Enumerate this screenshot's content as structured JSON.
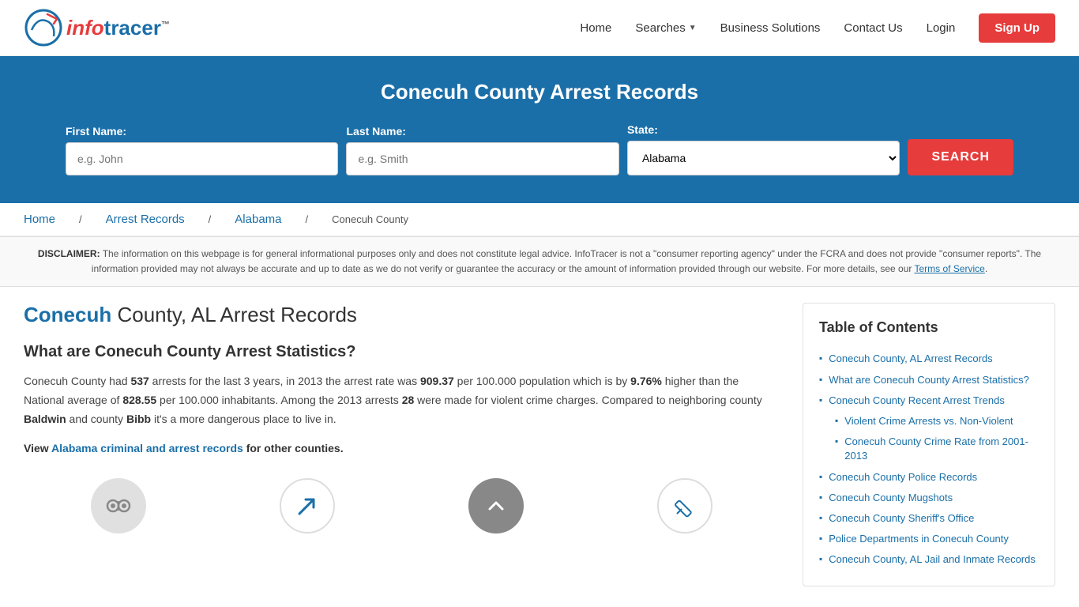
{
  "header": {
    "logo_info": "info",
    "logo_tracer": "tracer",
    "logo_tm": "™",
    "nav": {
      "home": "Home",
      "searches": "Searches",
      "business_solutions": "Business Solutions",
      "contact_us": "Contact Us",
      "login": "Login",
      "signup": "Sign Up"
    }
  },
  "hero": {
    "title": "Conecuh County Arrest Records",
    "form": {
      "first_name_label": "First Name:",
      "first_name_placeholder": "e.g. John",
      "last_name_label": "Last Name:",
      "last_name_placeholder": "e.g. Smith",
      "state_label": "State:",
      "state_default": "Alabama",
      "search_button": "SEARCH"
    }
  },
  "breadcrumb": {
    "home": "Home",
    "arrest_records": "Arrest Records",
    "alabama": "Alabama",
    "county": "Conecuh County"
  },
  "disclaimer": {
    "label": "DISCLAIMER:",
    "text": "The information on this webpage is for general informational purposes only and does not constitute legal advice. InfoTracer is not a \"consumer reporting agency\" under the FCRA and does not provide \"consumer reports\". The information provided may not always be accurate and up to date as we do not verify or guarantee the accuracy or the amount of information provided through our website. For more details, see our",
    "link_text": "Terms of Service",
    "period": "."
  },
  "article": {
    "title_highlight": "Conecuh",
    "title_rest": " County, AL Arrest Records",
    "subtitle": "What are Conecuh County Arrest Statistics?",
    "body1_pre": "Conecuh County had ",
    "body1_arrests": "537",
    "body1_mid1": " arrests for the last 3 years, in 2013 the arrest rate was ",
    "body1_rate": "909.37",
    "body1_mid2": " per 100.000 population which is by ",
    "body1_pct": "9.76%",
    "body1_mid3": " higher than the National average of ",
    "body1_avg": "828.55",
    "body1_mid4": " per 100.000 inhabitants. Among the 2013 arrests ",
    "body1_violent": "28",
    "body1_mid5": " were made for violent crime charges. Compared to neighboring county ",
    "body1_county1": "Baldwin",
    "body1_mid6": " and county ",
    "body1_county2": "Bibb",
    "body1_end": " it's a more dangerous place to live in.",
    "view_pre": "View ",
    "view_link_text": "Alabama criminal and arrest records",
    "view_post": " for other counties."
  },
  "toc": {
    "title": "Table of Contents",
    "items": [
      {
        "text": "Conecuh County, AL Arrest Records",
        "sub": false
      },
      {
        "text": "What are Conecuh County Arrest Statistics?",
        "sub": false
      },
      {
        "text": "Conecuh County Recent Arrest Trends",
        "sub": false
      },
      {
        "text": "Violent Crime Arrests vs. Non-Violent",
        "sub": true
      },
      {
        "text": "Conecuh County Crime Rate from 2001-2013",
        "sub": true
      },
      {
        "text": "Conecuh County Police Records",
        "sub": false
      },
      {
        "text": "Conecuh County Mugshots",
        "sub": false
      },
      {
        "text": "Conecuh County Sheriff's Office",
        "sub": false
      },
      {
        "text": "Police Departments in Conecuh County",
        "sub": false
      },
      {
        "text": "Conecuh County, AL Jail and Inmate Records",
        "sub": false
      }
    ]
  }
}
